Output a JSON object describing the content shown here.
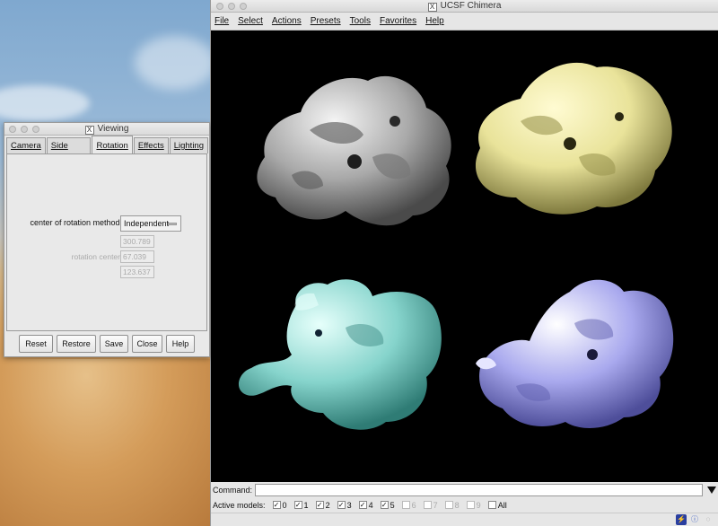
{
  "chimera": {
    "title": "UCSF Chimera",
    "menu": [
      "File",
      "Select",
      "Actions",
      "Presets",
      "Tools",
      "Favorites",
      "Help"
    ],
    "command_label": "Command:",
    "command_value": "",
    "active_models_label": "Active models:",
    "models": [
      {
        "label": "0",
        "checked": true,
        "enabled": true
      },
      {
        "label": "1",
        "checked": true,
        "enabled": true
      },
      {
        "label": "2",
        "checked": true,
        "enabled": true
      },
      {
        "label": "3",
        "checked": true,
        "enabled": true
      },
      {
        "label": "4",
        "checked": true,
        "enabled": true
      },
      {
        "label": "5",
        "checked": true,
        "enabled": true
      },
      {
        "label": "6",
        "checked": false,
        "enabled": false
      },
      {
        "label": "7",
        "checked": false,
        "enabled": false
      },
      {
        "label": "8",
        "checked": false,
        "enabled": false
      },
      {
        "label": "9",
        "checked": false,
        "enabled": false
      }
    ],
    "all_label": "All",
    "surface_colors": [
      "#a9a9a9",
      "#e9e39a",
      "#86d4cc",
      "#a9a9ee"
    ]
  },
  "viewing": {
    "title": "Viewing",
    "tabs": [
      "Camera",
      "Side View",
      "Rotation",
      "Effects",
      "Lighting"
    ],
    "active_tab": "Rotation",
    "center_method_label": "center of rotation method:",
    "center_method_value": "Independent",
    "rotation_center_label": "rotation center",
    "rotation_center": [
      "300.789",
      "67.039",
      "123.637"
    ],
    "buttons": [
      "Reset",
      "Restore",
      "Save",
      "Close",
      "Help"
    ]
  }
}
